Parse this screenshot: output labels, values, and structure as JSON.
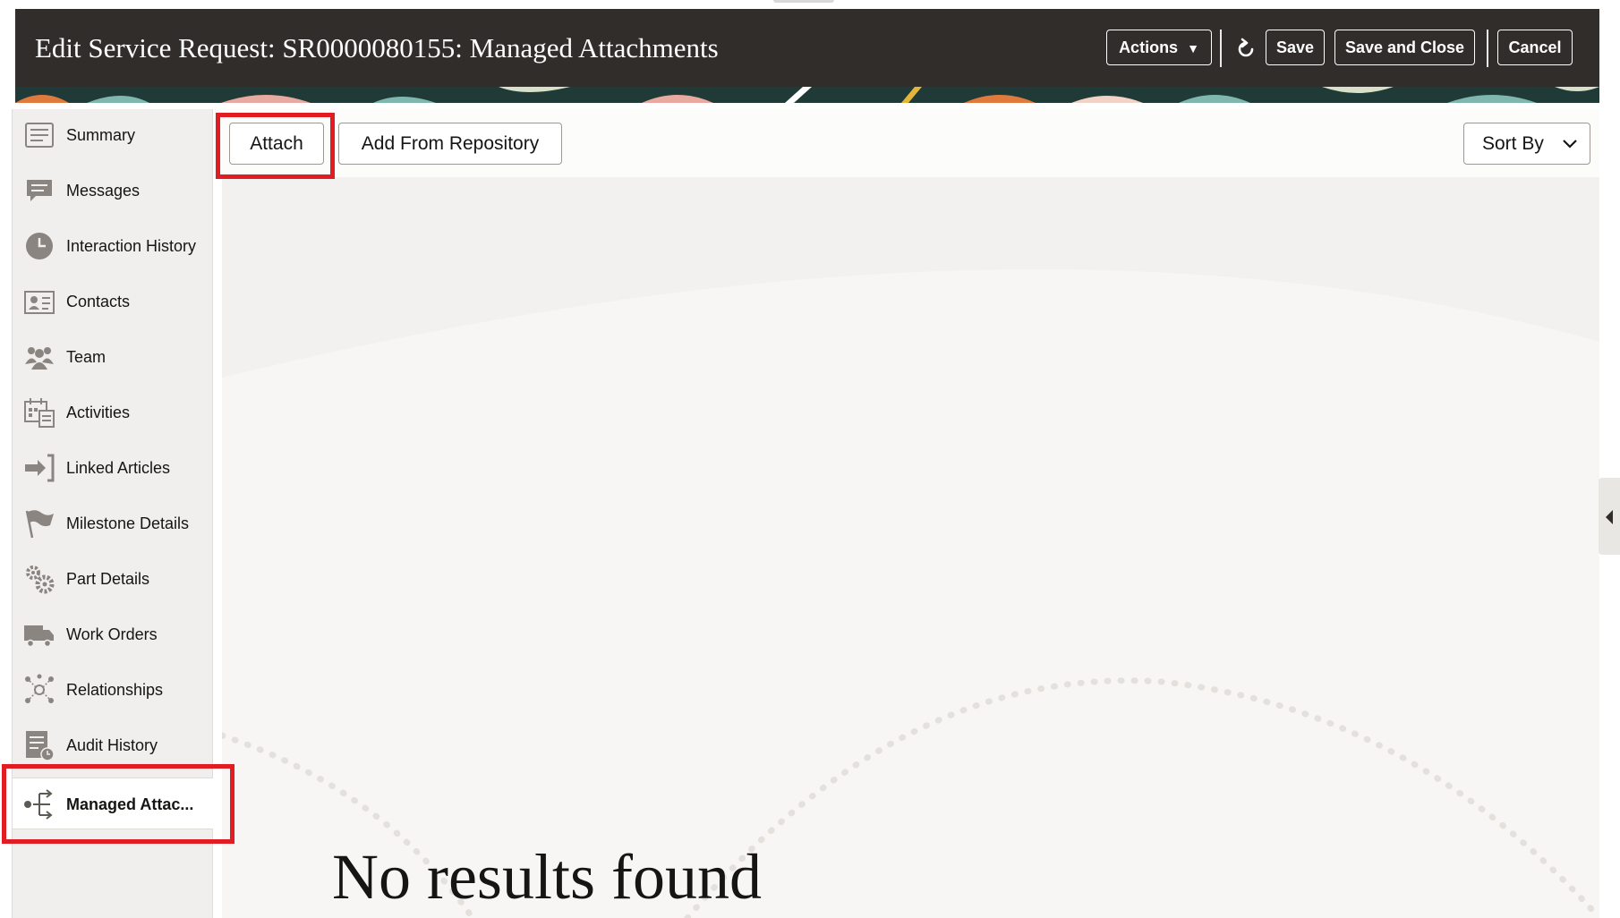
{
  "header": {
    "title": "Edit Service Request: SR0000080155: Managed Attachments",
    "actions_label": "Actions",
    "refresh_icon": "refresh-icon",
    "save_label": "Save",
    "save_close_label": "Save and Close",
    "cancel_label": "Cancel"
  },
  "sidebar": {
    "items": [
      {
        "label": "Summary",
        "icon": "summary-list-icon"
      },
      {
        "label": "Messages",
        "icon": "messages-icon"
      },
      {
        "label": "Interaction History",
        "icon": "clock-icon"
      },
      {
        "label": "Contacts",
        "icon": "contact-card-icon"
      },
      {
        "label": "Team",
        "icon": "team-icon"
      },
      {
        "label": "Activities",
        "icon": "calendar-icon"
      },
      {
        "label": "Linked Articles",
        "icon": "linked-article-icon"
      },
      {
        "label": "Milestone Details",
        "icon": "flag-icon"
      },
      {
        "label": "Part Details",
        "icon": "gears-icon"
      },
      {
        "label": "Work Orders",
        "icon": "truck-icon"
      },
      {
        "label": "Relationships",
        "icon": "relationships-icon"
      },
      {
        "label": "Audit History",
        "icon": "audit-history-icon"
      },
      {
        "label": "Managed Attac...",
        "icon": "managed-attachments-icon",
        "selected": true
      }
    ]
  },
  "toolbar": {
    "attach_label": "Attach",
    "add_repo_label": "Add From Repository",
    "sort_label": "Sort By"
  },
  "main": {
    "empty_message": "No results found"
  },
  "colors": {
    "header_bg": "#312d2a",
    "highlight": "#e21c23",
    "nav_bg": "#f1efed",
    "content_bg": "#f7f6f5"
  }
}
